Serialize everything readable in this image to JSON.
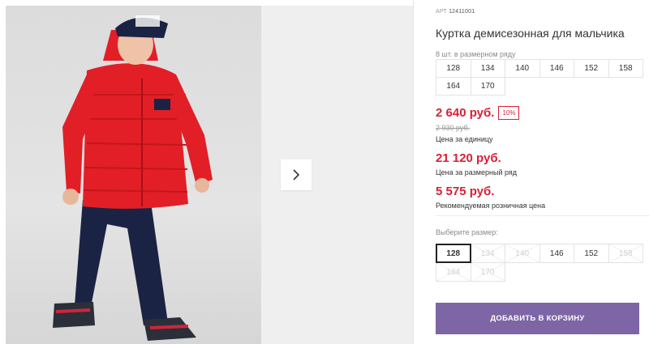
{
  "product": {
    "article_prefix": "АРТ",
    "article": "12411001",
    "title": "Куртка демисезонная для мальчика"
  },
  "pack": {
    "label": "8 шт. в размерном ряду",
    "sizes": [
      "128",
      "134",
      "140",
      "146",
      "152",
      "158",
      "164",
      "170"
    ]
  },
  "pricing": {
    "unit_price": "2 640 руб.",
    "discount": "10%",
    "old_price": "2 930 руб.",
    "unit_note": "Цена за единицу",
    "pack_price": "21 120 руб.",
    "pack_note": "Цена за размерный ряд",
    "retail_price": "5 575 руб.",
    "retail_note": "Рекомендуемая розничная цена"
  },
  "size_picker": {
    "label": "Выберите размер:",
    "options": [
      {
        "size": "128",
        "state": "selected"
      },
      {
        "size": "134",
        "state": "disabled"
      },
      {
        "size": "140",
        "state": "disabled"
      },
      {
        "size": "146",
        "state": "available"
      },
      {
        "size": "152",
        "state": "available"
      },
      {
        "size": "158",
        "state": "disabled"
      },
      {
        "size": "164",
        "state": "disabled"
      },
      {
        "size": "170",
        "state": "disabled"
      }
    ]
  },
  "cart": {
    "label": "ДОБАВИТЬ В КОРЗИНУ"
  },
  "colors": {
    "price_red": "#d91f34",
    "button_purple": "#7d65a6"
  },
  "icons": {
    "next": "chevron-right-icon"
  }
}
